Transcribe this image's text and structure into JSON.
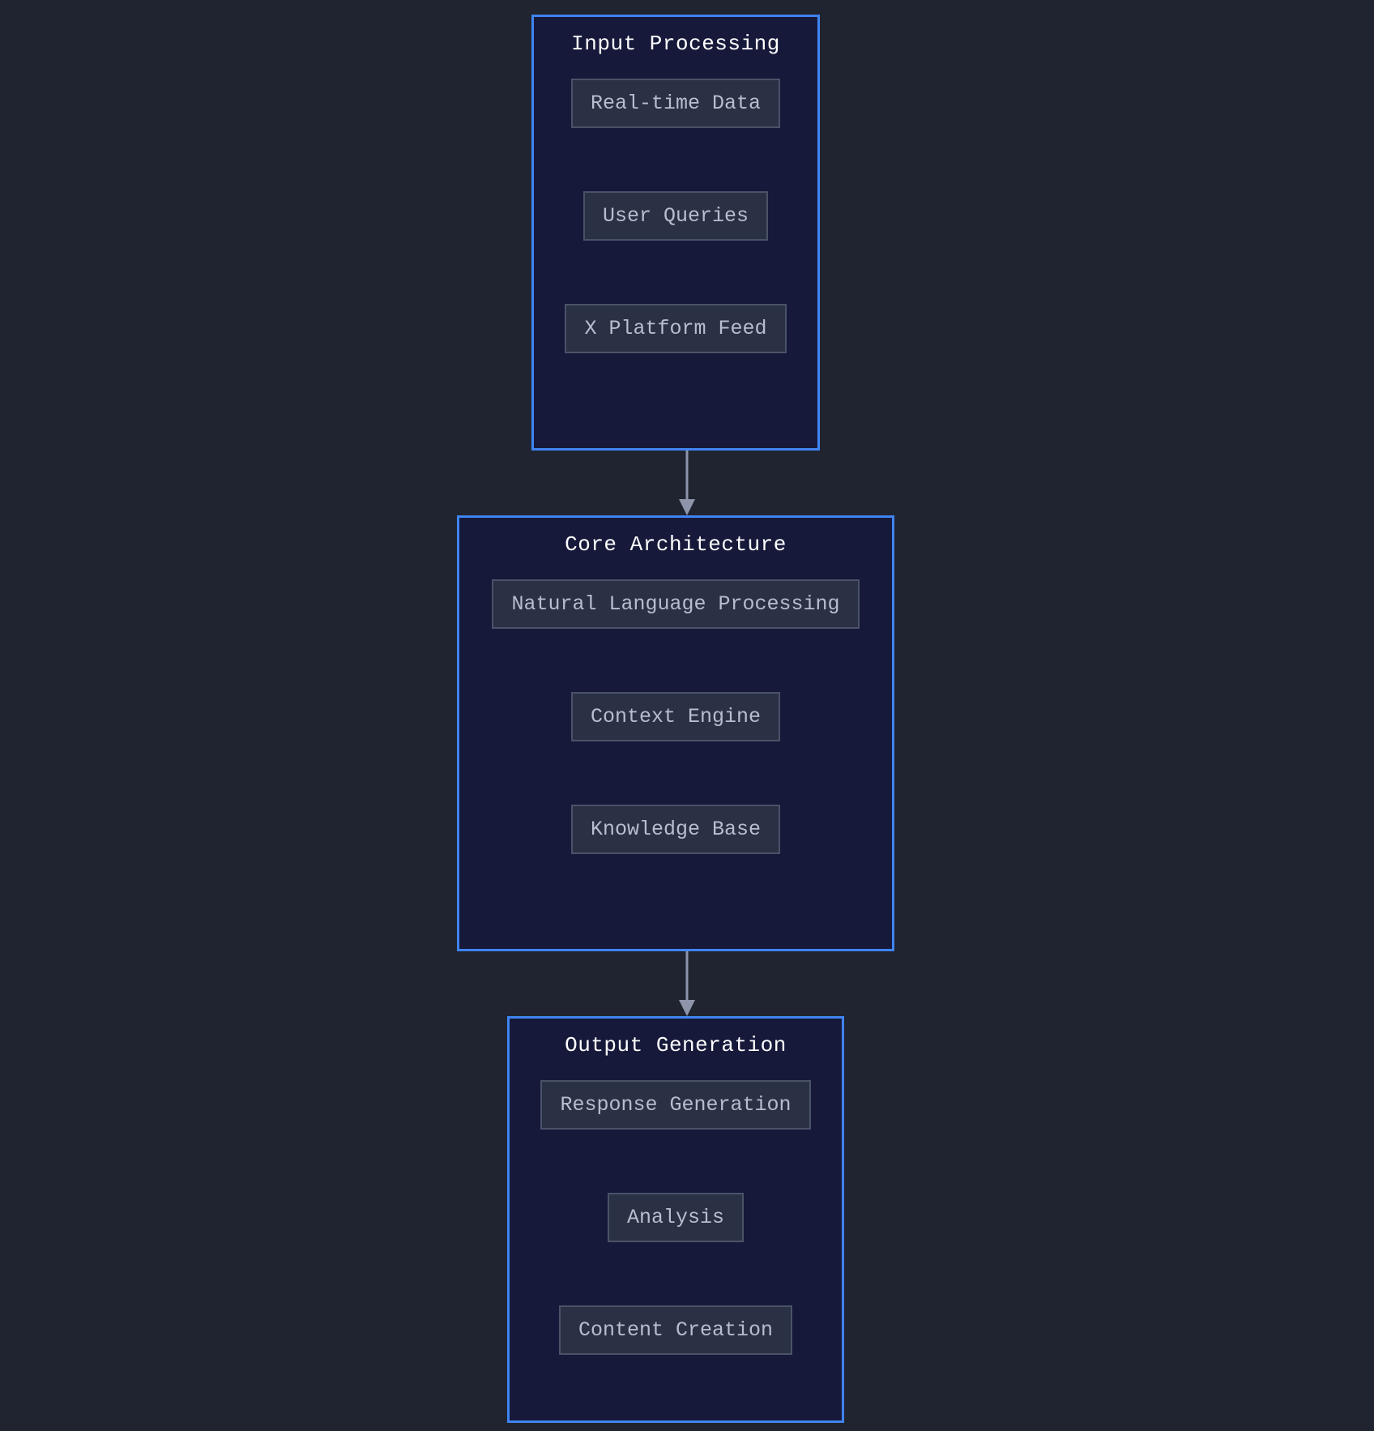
{
  "diagram": {
    "stages": [
      {
        "title": "Input Processing",
        "items": [
          "Real-time Data",
          "User Queries",
          "X Platform Feed"
        ]
      },
      {
        "title": "Core Architecture",
        "items": [
          "Natural Language Processing",
          "Context Engine",
          "Knowledge Base"
        ]
      },
      {
        "title": "Output Generation",
        "items": [
          "Response Generation",
          "Analysis",
          "Content Creation"
        ]
      }
    ]
  },
  "colors": {
    "background": "#1f2430",
    "stage_fill": "#16193a",
    "stage_border": "#3f84f2",
    "item_fill": "#2b3144",
    "item_border": "#4a5268",
    "item_text": "#b7becf",
    "title_text": "#ffffff",
    "arrow": "#8e95ab"
  }
}
